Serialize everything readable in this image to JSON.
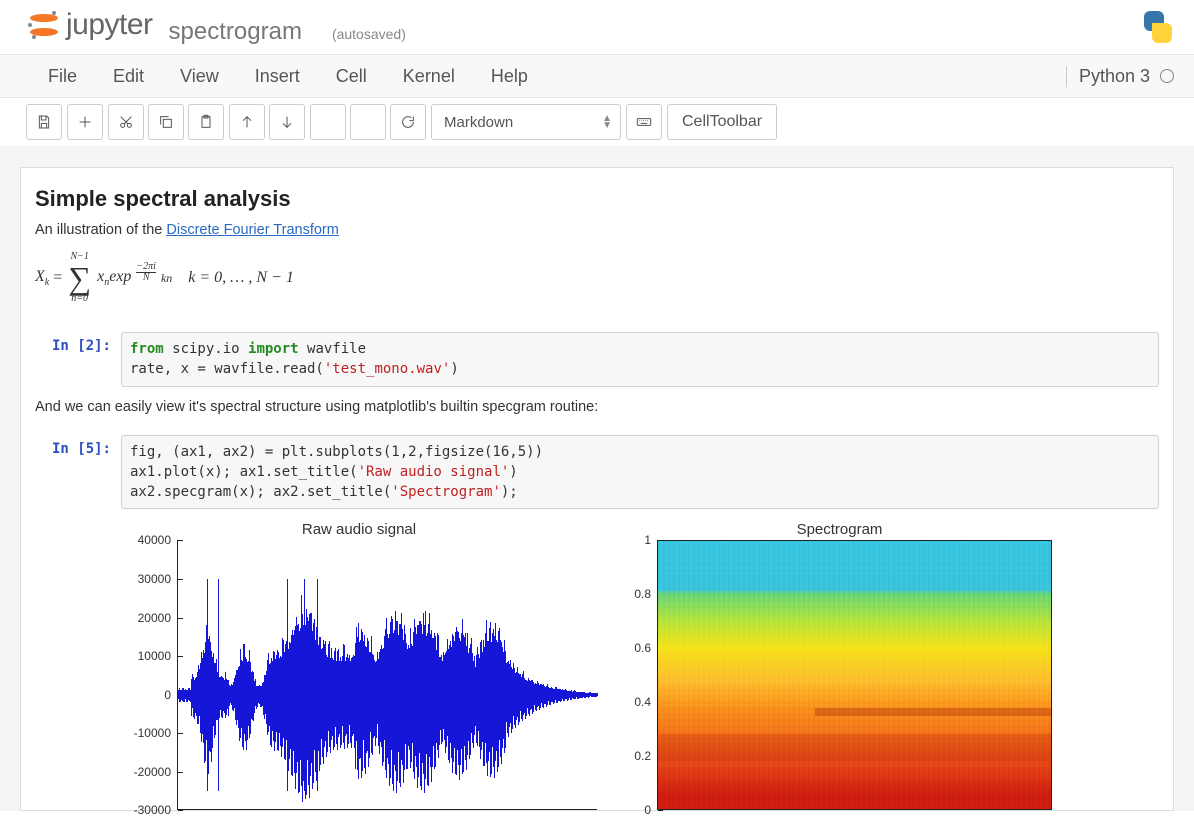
{
  "header": {
    "logo_text": "jupyter",
    "notebook_name": "spectrogram",
    "autosave": "(autosaved)"
  },
  "menubar": {
    "items": [
      "File",
      "Edit",
      "View",
      "Insert",
      "Cell",
      "Kernel",
      "Help"
    ],
    "kernel_name": "Python 3"
  },
  "toolbar": {
    "cell_type_value": "Markdown",
    "cell_toolbar_label": "CellToolbar",
    "buttons": {
      "save": "save",
      "add": "add-cell",
      "cut": "cut",
      "copy": "copy",
      "paste": "paste",
      "up": "move-up",
      "down": "move-down",
      "run": "run",
      "stop": "interrupt",
      "restart": "restart",
      "keyboard": "command-palette"
    }
  },
  "cells": {
    "md1": {
      "heading": "Simple spectral analysis",
      "intro_prefix": "An illustration of the ",
      "intro_link": "Discrete Fourier Transform",
      "formula_desc": "X_k = sum_{n=0}^{N-1} x_n exp(-2πi/N kn),  k = 0, …, N − 1"
    },
    "code1": {
      "prompt": "In [2]:",
      "line1_a": "from",
      "line1_b": " scipy.io ",
      "line1_c": "import",
      "line1_d": " wavfile",
      "line2_a": "rate, x = wavfile.read(",
      "line2_b": "'test_mono.wav'",
      "line2_c": ")"
    },
    "md2": {
      "text": "And we can easily view it's spectral structure using matplotlib's builtin specgram routine:"
    },
    "code2": {
      "prompt": "In [5]:",
      "l1": "fig, (ax1, ax2) = plt.subplots(1,2,figsize(16,5))",
      "l2a": "ax1.plot(x); ax1.set_title(",
      "l2b": "'Raw audio signal'",
      "l2c": ")",
      "l3a": "ax2.specgram(x); ax2.set_title(",
      "l3b": "'Spectrogram'",
      "l3c": ");"
    }
  },
  "chart_data": [
    {
      "type": "line",
      "title": "Raw audio signal",
      "xlabel": "",
      "ylabel": "",
      "ylim": [
        -30000,
        40000
      ],
      "yticks": [
        40000,
        30000,
        20000,
        10000,
        0,
        -10000,
        -20000,
        -30000
      ],
      "note": "Dense blue audio waveform oscillating roughly between -25000 and 30000 with bursts near samples 10k-70k; data is a raw WAV signal and not enumerated per-sample."
    },
    {
      "type": "heatmap",
      "title": "Spectrogram",
      "xlabel": "",
      "ylabel": "",
      "ylim": [
        0.0,
        1.0
      ],
      "yticks": [
        1.0,
        0.8,
        0.6,
        0.4,
        0.2,
        0.0
      ],
      "note": "Spectrogram heatmap: warm (red/orange) energy concentrated at low normalized frequency (0–0.4), cooler cyan at high frequency, with vertical striations across time."
    }
  ]
}
